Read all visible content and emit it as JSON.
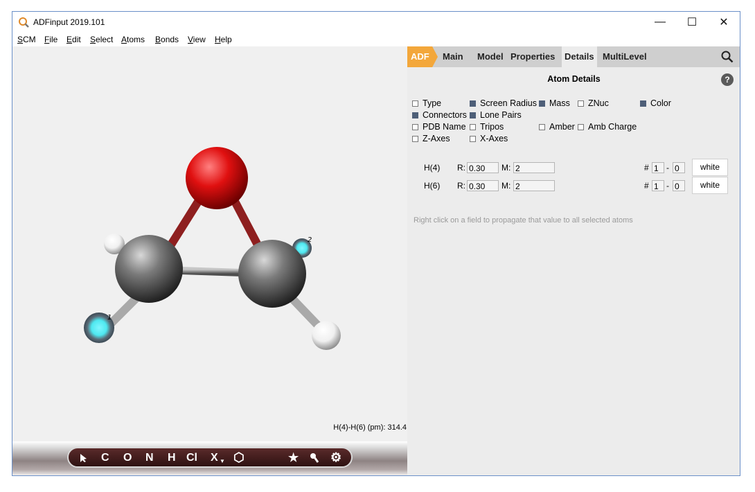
{
  "window": {
    "title": "ADFinput 2019.101",
    "controls": {
      "minimize": "—",
      "maximize": "☐",
      "close": "✕"
    }
  },
  "menu": {
    "items": [
      {
        "ul": "S",
        "rest": "CM"
      },
      {
        "ul": "F",
        "rest": "ile"
      },
      {
        "ul": "E",
        "rest": "dit"
      },
      {
        "ul": "S",
        "rest": "elect"
      },
      {
        "ul": "A",
        "rest": "toms"
      },
      {
        "ul": "B",
        "rest": "onds"
      },
      {
        "ul": "V",
        "rest": "iew"
      },
      {
        "ul": "H",
        "rest": "elp"
      }
    ]
  },
  "viewport": {
    "status": "H(4)-H(6) (pm): 314.4",
    "atom_labels": {
      "h_left": "1",
      "h_right": "2"
    },
    "toolbar": [
      "C",
      "O",
      "N",
      "H",
      "Cl",
      "X",
      "⬡",
      "★",
      "🔍",
      "⚙"
    ],
    "atom_colors": {
      "oxygen": "#e01010",
      "carbon": "#6a6a6a",
      "hydrogen": "#ffffff",
      "selected": "#4ee8f0",
      "bond_red": "#8e1f1f"
    }
  },
  "panel": {
    "tabs": [
      "ADF",
      "Main",
      "Model",
      "Properties",
      "Details",
      "MultiLevel"
    ],
    "active_tab": "Details",
    "section_title": "Atom Details",
    "options": [
      {
        "label": "Type",
        "checked": false
      },
      {
        "label": "Screen Radius",
        "checked": true
      },
      {
        "label": "Mass",
        "checked": true
      },
      {
        "label": "ZNuc",
        "checked": false
      },
      {
        "label": "Color",
        "checked": true
      },
      {
        "label": "Connectors",
        "checked": true
      },
      {
        "label": "Lone Pairs",
        "checked": true
      },
      {
        "label": "PDB Name",
        "checked": false
      },
      {
        "label": "Tripos",
        "checked": false
      },
      {
        "label": "Amber",
        "checked": false
      },
      {
        "label": "Amb Charge",
        "checked": false
      },
      {
        "label": "Z-Axes",
        "checked": false
      },
      {
        "label": "X-Axes",
        "checked": false
      }
    ],
    "rows": [
      {
        "atom": "H(4)",
        "r_label": "R:",
        "r": "0.30",
        "m_label": "M:",
        "m": "2",
        "hash": "#",
        "from": "1",
        "dash": "-",
        "to": "0",
        "color": "white"
      },
      {
        "atom": "H(6)",
        "r_label": "R:",
        "r": "0.30",
        "m_label": "M:",
        "m": "2",
        "hash": "#",
        "from": "1",
        "dash": "-",
        "to": "0",
        "color": "white"
      }
    ],
    "hint": "Right click on a field to propagate that value to all selected atoms"
  }
}
